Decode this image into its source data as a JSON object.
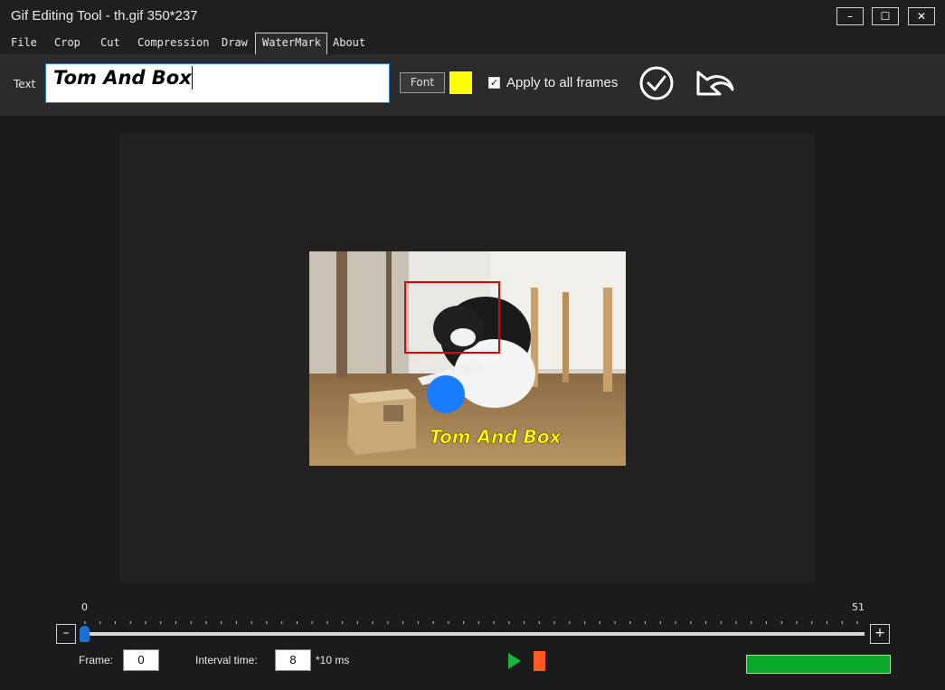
{
  "window": {
    "title": "Gif Editing Tool - th.gif 350*237",
    "controls": [
      "–",
      "☐",
      "✕"
    ]
  },
  "menu": {
    "items": [
      "File",
      "Crop",
      "Cut",
      "Compression",
      "Draw",
      "WaterMark",
      "About"
    ],
    "active": "WaterMark"
  },
  "toolbar": {
    "text_label": "Text",
    "text_value": "Tom And Box",
    "font_button": "Font",
    "watermark_color": "#ffff00",
    "apply_all_checked": true,
    "apply_all_label": "Apply to all frames",
    "confirm_icon": "check-circle-icon",
    "undo_icon": "undo-arrow-icon"
  },
  "preview": {
    "watermark_text": "Tom And Box",
    "watermark_color": "#ffff00",
    "rect_color": "#e00000",
    "circle_color": "#1a7cff"
  },
  "timeline": {
    "min_label": "0",
    "max_label": "51",
    "minus": "–",
    "plus": "+",
    "frame_label": "Frame:",
    "frame_value": "0",
    "interval_label": "Interval time:",
    "interval_value": "8",
    "interval_unit": "*10 ms",
    "progress_color": "#0aa82a"
  }
}
